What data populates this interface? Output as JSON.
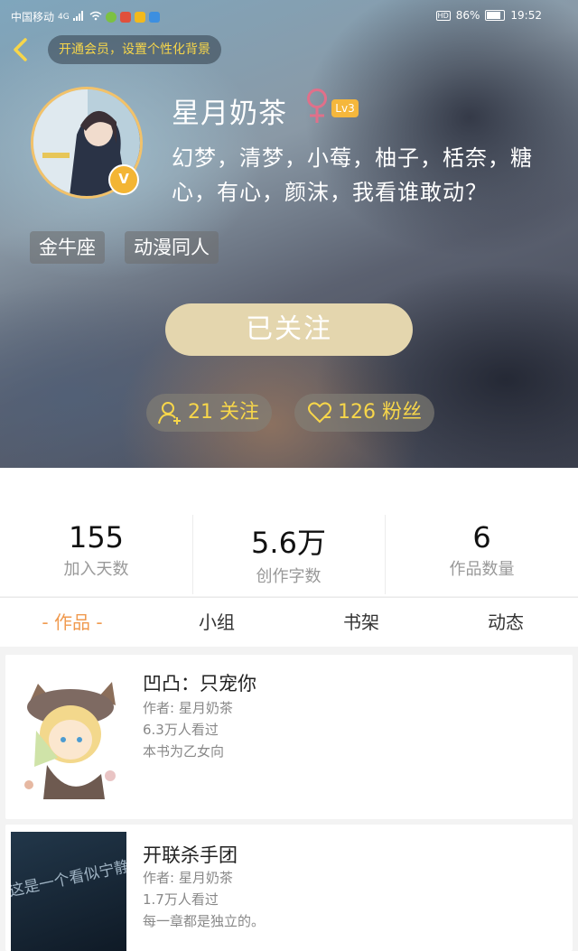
{
  "status_bar": {
    "carrier": "中国移动",
    "network": "4G",
    "battery": "86%",
    "time": "19:52"
  },
  "header": {
    "vip_banner": "开通会员，设置个性化背景",
    "username": "星月奶茶",
    "gender_symbol": "♀",
    "level": "Lv3",
    "vip_badge": "V",
    "bio": "幻梦，清梦，小莓，柚子，栝奈，糖心，有心，颜沫，我看谁敢动？",
    "tags": [
      "金牛座",
      "动漫同人"
    ],
    "follow_button": "已关注",
    "following_label": "21 关注",
    "fans_label": "126 粉丝"
  },
  "stats": [
    {
      "value": "155",
      "label": "加入天数"
    },
    {
      "value": "5.6万",
      "label": "创作字数"
    },
    {
      "value": "6",
      "label": "作品数量"
    }
  ],
  "tabs": [
    {
      "label": "- 作品 -",
      "active": true
    },
    {
      "label": "小组",
      "active": false
    },
    {
      "label": "书架",
      "active": false
    },
    {
      "label": "动态",
      "active": false
    }
  ],
  "books": [
    {
      "title": "凹凸：只宠你",
      "author": "作者: 星月奶茶",
      "views": "6.3万人看过",
      "desc": "本书为乙女向"
    },
    {
      "title": "开联杀手团",
      "author": "作者: 星月奶茶",
      "views": "1.7万人看过",
      "desc": "每一章都是独立的。",
      "cover_text": "这是一个看似宁静"
    }
  ],
  "colors": {
    "accent_yellow": "#f7d64a",
    "tab_active": "#f09a4f",
    "follow_button_bg": "#e4d6ae",
    "level_badge": "#f5b73c",
    "avatar_ring": "#f2c26a",
    "gender_pink": "#e0708a"
  }
}
